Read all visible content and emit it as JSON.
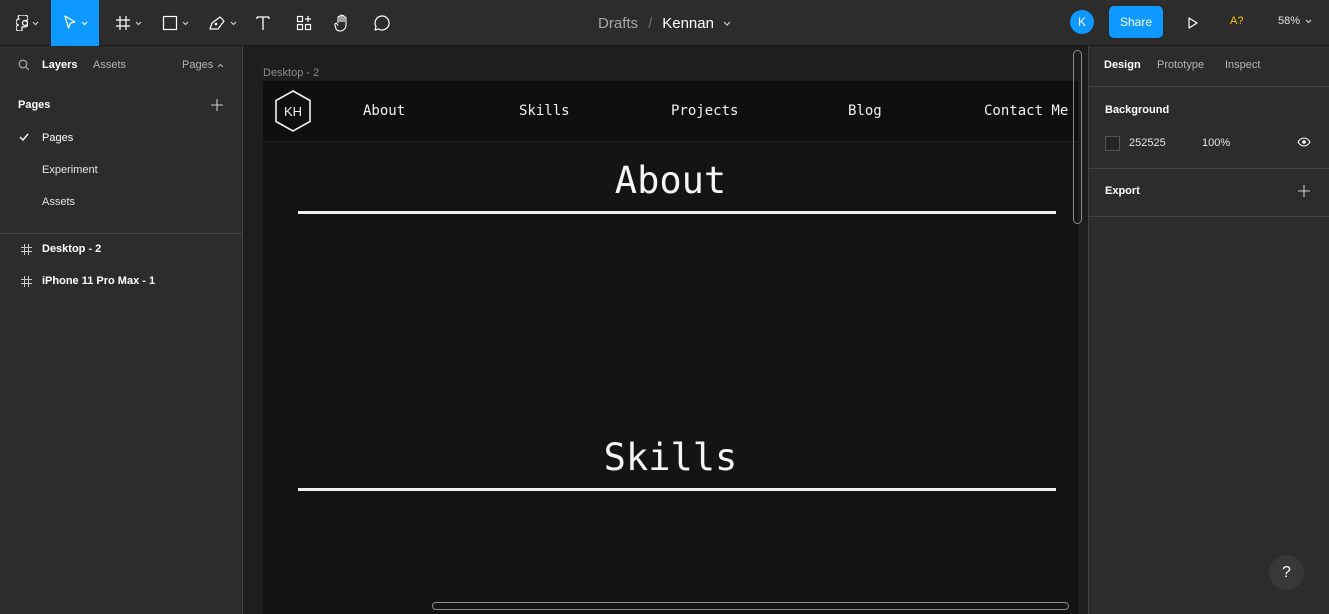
{
  "toolbar": {
    "breadcrumb_folder": "Drafts",
    "breadcrumb_sep": "/",
    "file_name": "Kennan",
    "avatar_initial": "K",
    "share_label": "Share",
    "warning_label": "A?",
    "zoom_label": "58%"
  },
  "left_panel": {
    "tab_layers": "Layers",
    "tab_assets": "Assets",
    "tab_pages": "Pages",
    "pages_heading": "Pages",
    "pages": [
      "Pages",
      "Experiment",
      "Assets"
    ],
    "layers": [
      "Desktop - 2",
      "iPhone 11 Pro Max - 1"
    ]
  },
  "canvas": {
    "frame_label": "Desktop - 2",
    "logo_text": "KH",
    "nav": [
      "About",
      "Skills",
      "Projects",
      "Blog",
      "Contact Me"
    ],
    "section_about": "About",
    "section_skills": "Skills"
  },
  "right_panel": {
    "tab_design": "Design",
    "tab_prototype": "Prototype",
    "tab_inspect": "Inspect",
    "background_heading": "Background",
    "background_hex": "252525",
    "background_opacity": "100%",
    "export_heading": "Export"
  },
  "help_label": "?",
  "colors": {
    "accent": "#0d99ff",
    "panel": "#2c2c2c",
    "canvas": "#1e1e1e",
    "frame_bg": "#141414",
    "warning": "#ffc700"
  }
}
